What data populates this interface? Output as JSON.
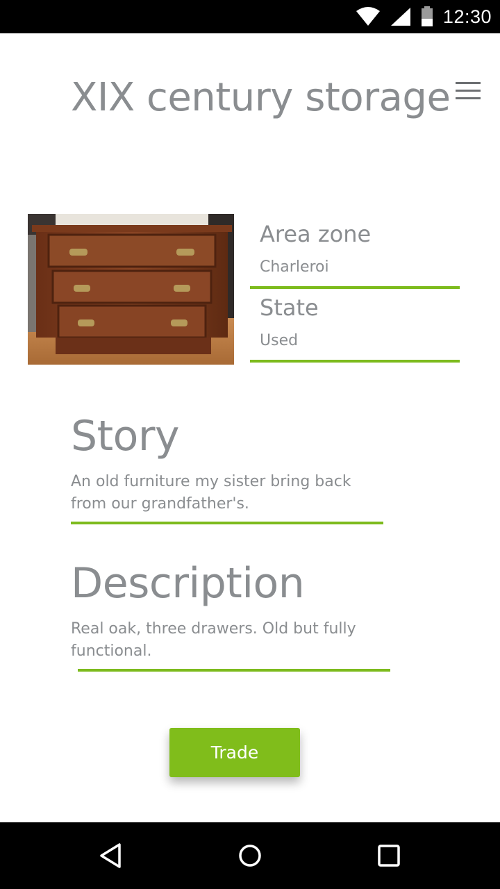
{
  "status_bar": {
    "time": "12:30",
    "icons": [
      "wifi-icon",
      "signal-icon",
      "battery-icon"
    ]
  },
  "header": {
    "title": "XIX century storage",
    "menu_icon": "hamburger-menu-icon"
  },
  "product": {
    "image_alt": "wooden chest of drawers",
    "fields": [
      {
        "label": "Area zone",
        "value": "Charleroi"
      },
      {
        "label": "State",
        "value": "Used"
      }
    ]
  },
  "story": {
    "heading": "Story",
    "text": "An old furniture my sister bring back from our grandfather's."
  },
  "description": {
    "heading": "Description",
    "text": "Real oak, three drawers. Old but fully functional."
  },
  "actions": {
    "trade_label": "Trade"
  },
  "nav_bar": {
    "icons": [
      "back-icon",
      "home-icon",
      "recents-icon"
    ]
  },
  "colors": {
    "accent": "#80bd1b",
    "text": "#8a8d90",
    "bars": "#000000"
  }
}
